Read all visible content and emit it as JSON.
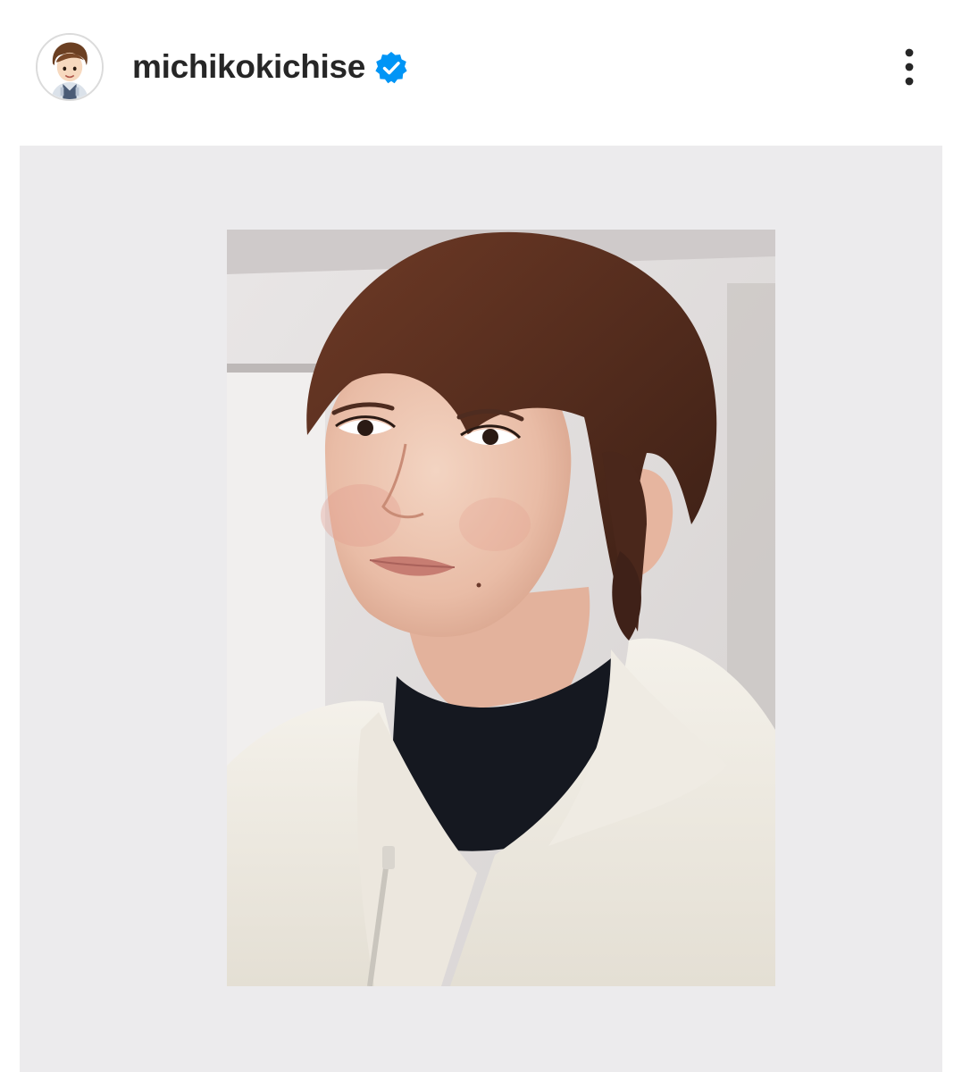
{
  "post": {
    "username": "michikokichise",
    "verified": true,
    "icons": {
      "avatar": "avatar-illustration",
      "verified": "verified-badge-icon",
      "more": "more-options-icon"
    },
    "colors": {
      "username_text": "#262626",
      "verified_badge": "#0095f6",
      "frame_background": "#ecebed"
    }
  }
}
